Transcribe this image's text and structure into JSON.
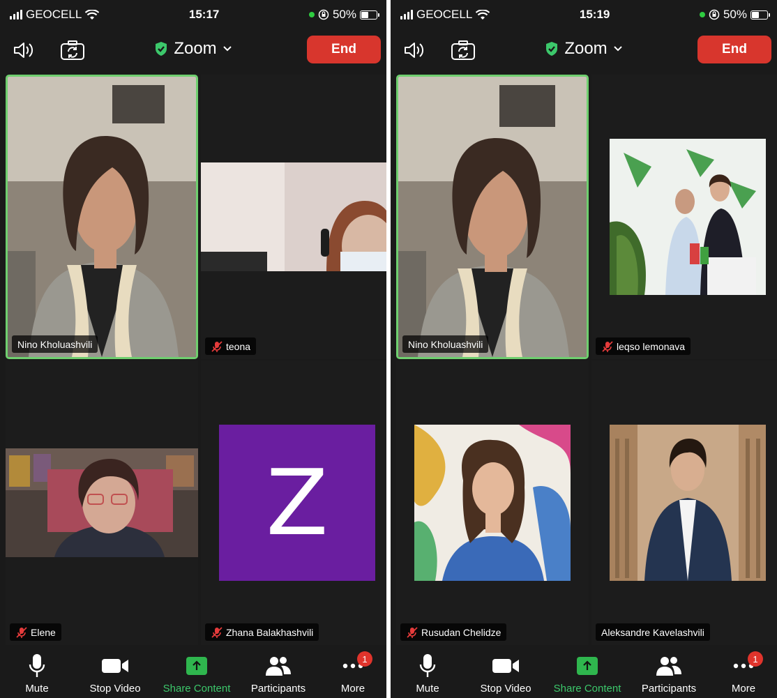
{
  "screens": [
    {
      "status_bar": {
        "carrier": "GEOCELL",
        "time": "15:17",
        "battery": "50%"
      },
      "header": {
        "title": "Zoom",
        "end_label": "End"
      },
      "tiles": [
        {
          "name": "Nino Kholuashvili",
          "muted": false,
          "active": true
        },
        {
          "name": "teona",
          "muted": true,
          "active": false
        },
        {
          "name": "Elene",
          "muted": true,
          "active": false
        },
        {
          "name": "Zhana Balakhashvili",
          "muted": true,
          "active": false,
          "avatar_letter": "Z"
        }
      ],
      "toolbar": {
        "mute": "Mute",
        "stop_video": "Stop Video",
        "share": "Share Content",
        "participants": "Participants",
        "more": "More",
        "more_badge": "1"
      }
    },
    {
      "status_bar": {
        "carrier": "GEOCELL",
        "time": "15:19",
        "battery": "50%"
      },
      "header": {
        "title": "Zoom",
        "end_label": "End"
      },
      "tiles": [
        {
          "name": "Nino Kholuashvili",
          "muted": false,
          "active": true
        },
        {
          "name": "leqso lemonava",
          "muted": true,
          "active": false
        },
        {
          "name": "Rusudan Chelidze",
          "muted": true,
          "active": false
        },
        {
          "name": "Aleksandre Kavelashvili",
          "muted": false,
          "active": false
        }
      ],
      "toolbar": {
        "mute": "Mute",
        "stop_video": "Stop Video",
        "share": "Share Content",
        "participants": "Participants",
        "more": "More",
        "more_badge": "1"
      }
    }
  ],
  "colors": {
    "end_button": "#d8362d",
    "active_border": "#6fcf6f",
    "share_green": "#2fb64e",
    "avatar_purple": "#6a1ea0",
    "badge_red": "#e0342c"
  },
  "icons": [
    "speaker-icon",
    "camera-flip-icon",
    "shield-check-icon",
    "chevron-down-icon",
    "mic-muted-icon",
    "microphone-icon",
    "video-camera-icon",
    "share-arrow-icon",
    "participants-icon",
    "more-dots-icon"
  ]
}
